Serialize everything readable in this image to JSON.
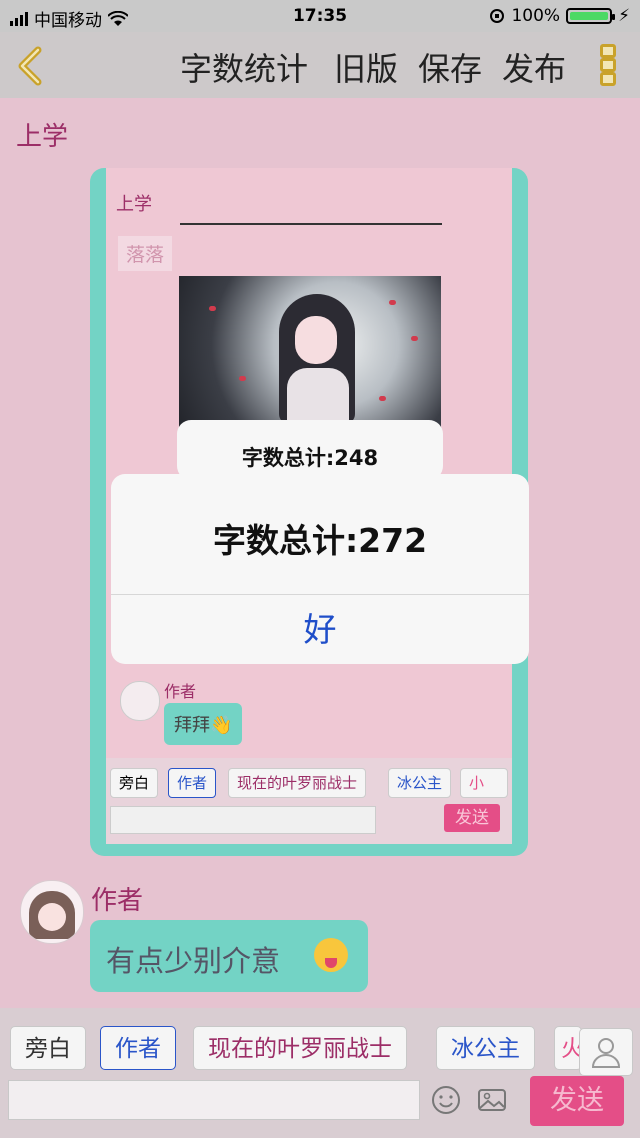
{
  "status_bar": {
    "carrier": "中国移动",
    "time": "17:35",
    "battery": "100%",
    "battery_level": 1.0
  },
  "nav": {
    "word_count": "字数统计",
    "old_version": "旧版",
    "save": "保存",
    "publish": "发布"
  },
  "content": {
    "title": "上学",
    "embedded_screenshot": {
      "title": "上学",
      "tag": "落落",
      "alert_text": "字数总计:248",
      "author": "作者",
      "message": "拜拜👋",
      "chips": [
        "旁白",
        "作者",
        "现在的叶罗丽战士",
        "冰公主",
        "小"
      ],
      "send": "发送"
    },
    "message": {
      "author": "作者",
      "text": "有点少别介意"
    }
  },
  "toolbar": {
    "chips": [
      "旁白",
      "作者",
      "现在的叶罗丽战士",
      "冰公主",
      "火"
    ],
    "send": "发送",
    "input_placeholder": ""
  },
  "alert": {
    "message": "字数总计:272",
    "ok": "好"
  },
  "colors": {
    "accent_teal": "#73d3c5",
    "send_pink": "#e44e87",
    "title_plum": "#9c2e67",
    "ok_blue": "#1f4ec9"
  }
}
